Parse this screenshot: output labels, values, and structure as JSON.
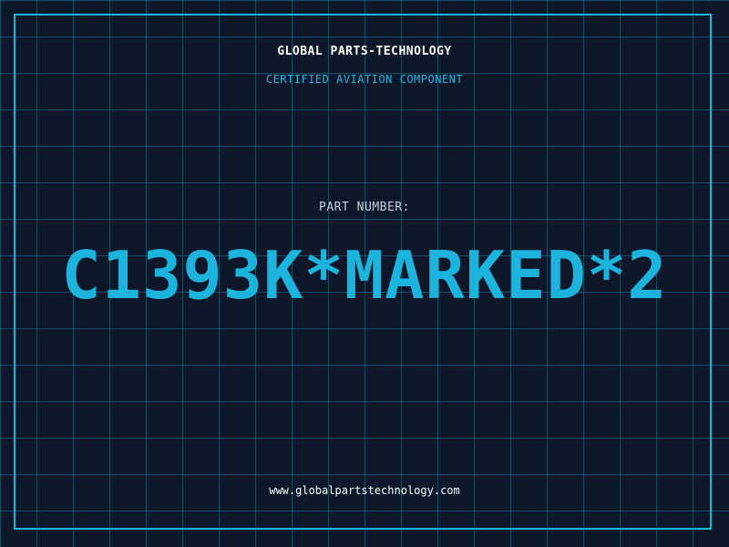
{
  "header": {
    "company": "GLOBAL PARTS-TECHNOLOGY",
    "subtitle": "CERTIFIED AVIATION COMPONENT"
  },
  "main": {
    "part_label": "PART NUMBER:",
    "part_number": "C1393K*MARKED*2"
  },
  "footer": {
    "website": "www.globalpartstechnology.com"
  },
  "colors": {
    "background": "#0f172a",
    "accent": "#1cb4dc",
    "grid": "#228caa",
    "text": "#ffffff"
  }
}
